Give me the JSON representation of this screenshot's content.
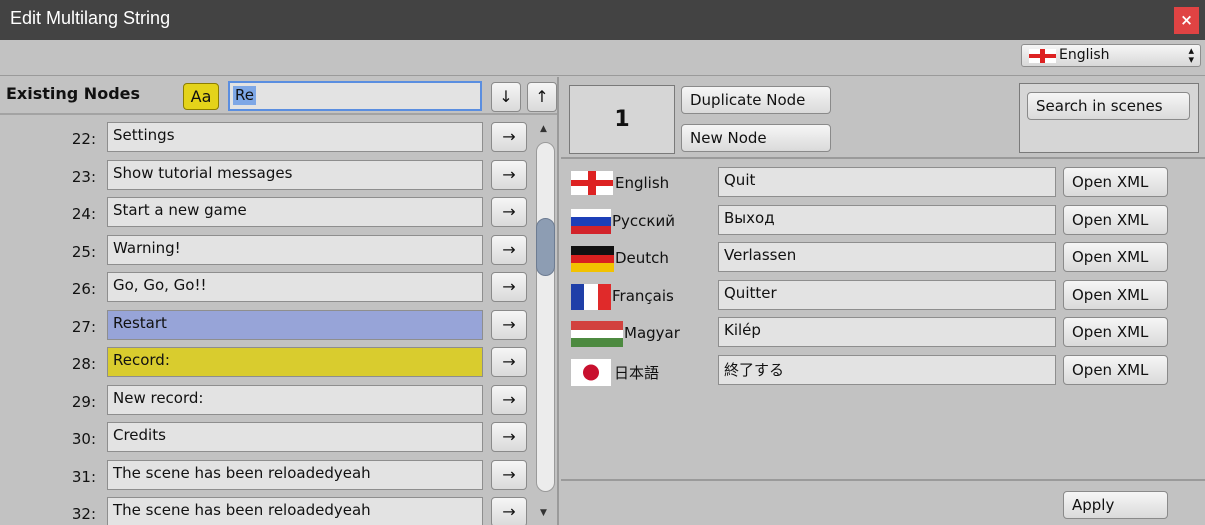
{
  "window": {
    "title": "Edit Multilang String",
    "close_glyph": "×"
  },
  "language_select": {
    "selected": "English",
    "arrows": "▴▾"
  },
  "left": {
    "header": "Existing Nodes",
    "case_button": "Aa",
    "search_value": "Re",
    "down_glyph": "↓",
    "up_glyph": "↑",
    "go_glyph": "→",
    "rows": [
      {
        "num": "22:",
        "text": "Settings",
        "hl": ""
      },
      {
        "num": "23:",
        "text": "Show tutorial messages",
        "hl": ""
      },
      {
        "num": "24:",
        "text": "Start a new game",
        "hl": ""
      },
      {
        "num": "25:",
        "text": "Warning!",
        "hl": ""
      },
      {
        "num": "26:",
        "text": "Go, Go, Go!!",
        "hl": ""
      },
      {
        "num": "27:",
        "text": "Restart",
        "hl": "blue"
      },
      {
        "num": "28:",
        "text": "Record:",
        "hl": "yellow"
      },
      {
        "num": "29:",
        "text": "New record:",
        "hl": ""
      },
      {
        "num": "30:",
        "text": "Credits",
        "hl": ""
      },
      {
        "num": "31:",
        "text": "The scene has been reloadedyeah",
        "hl": ""
      },
      {
        "num": "32:",
        "text": "The scene has been reloadedyeah",
        "hl": ""
      }
    ],
    "scroll_up": "▲",
    "scroll_down": "▼"
  },
  "right": {
    "node_number": "1",
    "duplicate_label": "Duplicate Node",
    "new_label": "New Node",
    "search_scenes_label": "Search in scenes",
    "open_xml_label": "Open XML",
    "languages": [
      {
        "name": "English",
        "value": "Quit",
        "flag": "england"
      },
      {
        "name": "Русский",
        "value": "Выход",
        "flag": "russia"
      },
      {
        "name": "Deutch",
        "value": "Verlassen",
        "flag": "germany"
      },
      {
        "name": "Français",
        "value": "Quitter",
        "flag": "france"
      },
      {
        "name": "Magyar",
        "value": "Kilép",
        "flag": "hungary"
      },
      {
        "name": "日本語",
        "value": "終了する",
        "flag": "japan"
      }
    ],
    "apply_label": "Apply"
  },
  "colors": {
    "titlebar": "#434343",
    "close": "#e04343",
    "highlight_blue": "#97a4d8",
    "highlight_yellow": "#d9cc2e",
    "search_border": "#5a8ee0"
  }
}
